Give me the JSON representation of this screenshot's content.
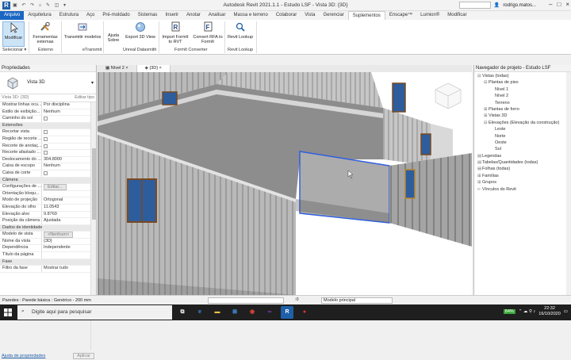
{
  "window": {
    "title": "Autodesk Revit 2021.1.1 - Estudo LSF - Vista 3D: {3D}",
    "user": "rodrigo.matos...",
    "app_letter": "R"
  },
  "tabs": [
    {
      "label": "Arquivo"
    },
    {
      "label": "Arquitetura"
    },
    {
      "label": "Estrutura"
    },
    {
      "label": "Aço"
    },
    {
      "label": "Pré-moldado"
    },
    {
      "label": "Sistemas"
    },
    {
      "label": "Inserir"
    },
    {
      "label": "Anotar"
    },
    {
      "label": "Analisar"
    },
    {
      "label": "Massa e terreno"
    },
    {
      "label": "Colaborar"
    },
    {
      "label": "Vista"
    },
    {
      "label": "Gerenciar"
    },
    {
      "label": "Suplementos"
    },
    {
      "label": "Enscape™"
    },
    {
      "label": "Lumion®"
    },
    {
      "label": "Modificar"
    }
  ],
  "ribbon": {
    "modificar": "Modificar",
    "ferramentas": "Ferramentas externas",
    "transmitir": "Transmitir modelos",
    "ajuda": "Ajuda Sobre",
    "export3d": "Export 3D View",
    "import_formit": "Import FormIt to RVT",
    "convert_rfa": "Convert RFA to FormIt",
    "revit_lookup": "Revit Lookup",
    "groups": {
      "selecionar": "Selecionar ▾",
      "externo": "Externo",
      "etransmit": "eTransmit",
      "datasmith": "Unreal Datasmith",
      "formit": "FormIt Converter",
      "lookup": "Revit Lookup"
    }
  },
  "properties": {
    "header": "Propriedades",
    "type_name": "Vista 3D",
    "filter_label": "Vista 3D: {3D}",
    "edit_type": "Editar tipo",
    "rows": [
      {
        "k": "Mostrar linhas ocu...",
        "v": "Por disciplina",
        "kind": "text"
      },
      {
        "k": "Estilo de exibição...",
        "v": "Nenhum",
        "kind": "text"
      },
      {
        "k": "Caminho do sol",
        "v": "",
        "kind": "check"
      },
      {
        "k": "Extensões",
        "v": "",
        "kind": "section"
      },
      {
        "k": "Recortar vista",
        "v": "",
        "kind": "check"
      },
      {
        "k": "Região de recorte ...",
        "v": "",
        "kind": "check"
      },
      {
        "k": "Recorte de anotaç...",
        "v": "",
        "kind": "check"
      },
      {
        "k": "Recorte afastado ...",
        "v": "",
        "kind": "check"
      },
      {
        "k": "Deslocamento do ...",
        "v": "304.8000",
        "kind": "text"
      },
      {
        "k": "Caixa de escopo",
        "v": "Nenhum",
        "kind": "text"
      },
      {
        "k": "Caixa de corte",
        "v": "",
        "kind": "check"
      },
      {
        "k": "Câmera",
        "v": "",
        "kind": "section"
      },
      {
        "k": "Configurações de ...",
        "v": "Editar...",
        "kind": "button"
      },
      {
        "k": "Orientação bloqu...",
        "v": "",
        "kind": "text"
      },
      {
        "k": "Modo de projeção",
        "v": "Ortogonal",
        "kind": "text"
      },
      {
        "k": "Elevação do olho",
        "v": "11.0543",
        "kind": "text"
      },
      {
        "k": "Elevação alvo",
        "v": "9.8769",
        "kind": "text"
      },
      {
        "k": "Posição da câmera",
        "v": "Ajustada",
        "kind": "text"
      },
      {
        "k": "Dados de identidade",
        "v": "",
        "kind": "section"
      },
      {
        "k": "Modelo de vista",
        "v": "<Nenhum>",
        "kind": "button"
      },
      {
        "k": "Nome da vista",
        "v": "{3D}",
        "kind": "text"
      },
      {
        "k": "Dependência",
        "v": "Independente",
        "kind": "text"
      },
      {
        "k": "Título da página",
        "v": "",
        "kind": "text"
      },
      {
        "k": "Fase",
        "v": "",
        "kind": "section"
      },
      {
        "k": "Filtro da fase",
        "v": "Mostrar tudo",
        "kind": "text"
      }
    ],
    "help_link": "Ajuda de propriedades",
    "apply": "Aplicar"
  },
  "view_tabs": [
    {
      "label": "Nível 2"
    },
    {
      "label": "{3D}"
    }
  ],
  "browser": {
    "header": "Navegador de projeto - Estudo LSF",
    "items": [
      {
        "label": "Vistas (todas)",
        "indent": 0,
        "tg": "⊟"
      },
      {
        "label": "Plantas de piso",
        "indent": 1,
        "tg": "⊟"
      },
      {
        "label": "Nível 1",
        "indent": 2,
        "tg": ""
      },
      {
        "label": "Nível 2",
        "indent": 2,
        "tg": ""
      },
      {
        "label": "Terreno",
        "indent": 2,
        "tg": ""
      },
      {
        "label": "Plantas de forro",
        "indent": 1,
        "tg": "⊞"
      },
      {
        "label": "Vistas 3D",
        "indent": 1,
        "tg": "⊞"
      },
      {
        "label": "Elevações (Elevação da construção)",
        "indent": 1,
        "tg": "⊟"
      },
      {
        "label": "Leste",
        "indent": 2,
        "tg": ""
      },
      {
        "label": "Norte",
        "indent": 2,
        "tg": ""
      },
      {
        "label": "Oeste",
        "indent": 2,
        "tg": ""
      },
      {
        "label": "Sul",
        "indent": 2,
        "tg": ""
      },
      {
        "label": "Legendas",
        "indent": 0,
        "tg": "▤"
      },
      {
        "label": "Tabelas/Quantidades (todas)",
        "indent": 0,
        "tg": "▤"
      },
      {
        "label": "Folhas (todas)",
        "indent": 0,
        "tg": "▤"
      },
      {
        "label": "Famílias",
        "indent": 0,
        "tg": "⊞"
      },
      {
        "label": "Grupos",
        "indent": 0,
        "tg": "⊞"
      },
      {
        "label": "Vínculos do Revit",
        "indent": 0,
        "tg": "∞"
      }
    ]
  },
  "status": {
    "text": "Paredes : Parede básica : Genérico - 200 mm",
    "zero": ":0",
    "model": "Modelo principal"
  },
  "taskbar": {
    "search_placeholder": "Digite aqui para pesquisar",
    "battery": "84%",
    "time": "22:32",
    "date": "16/10/2020"
  }
}
